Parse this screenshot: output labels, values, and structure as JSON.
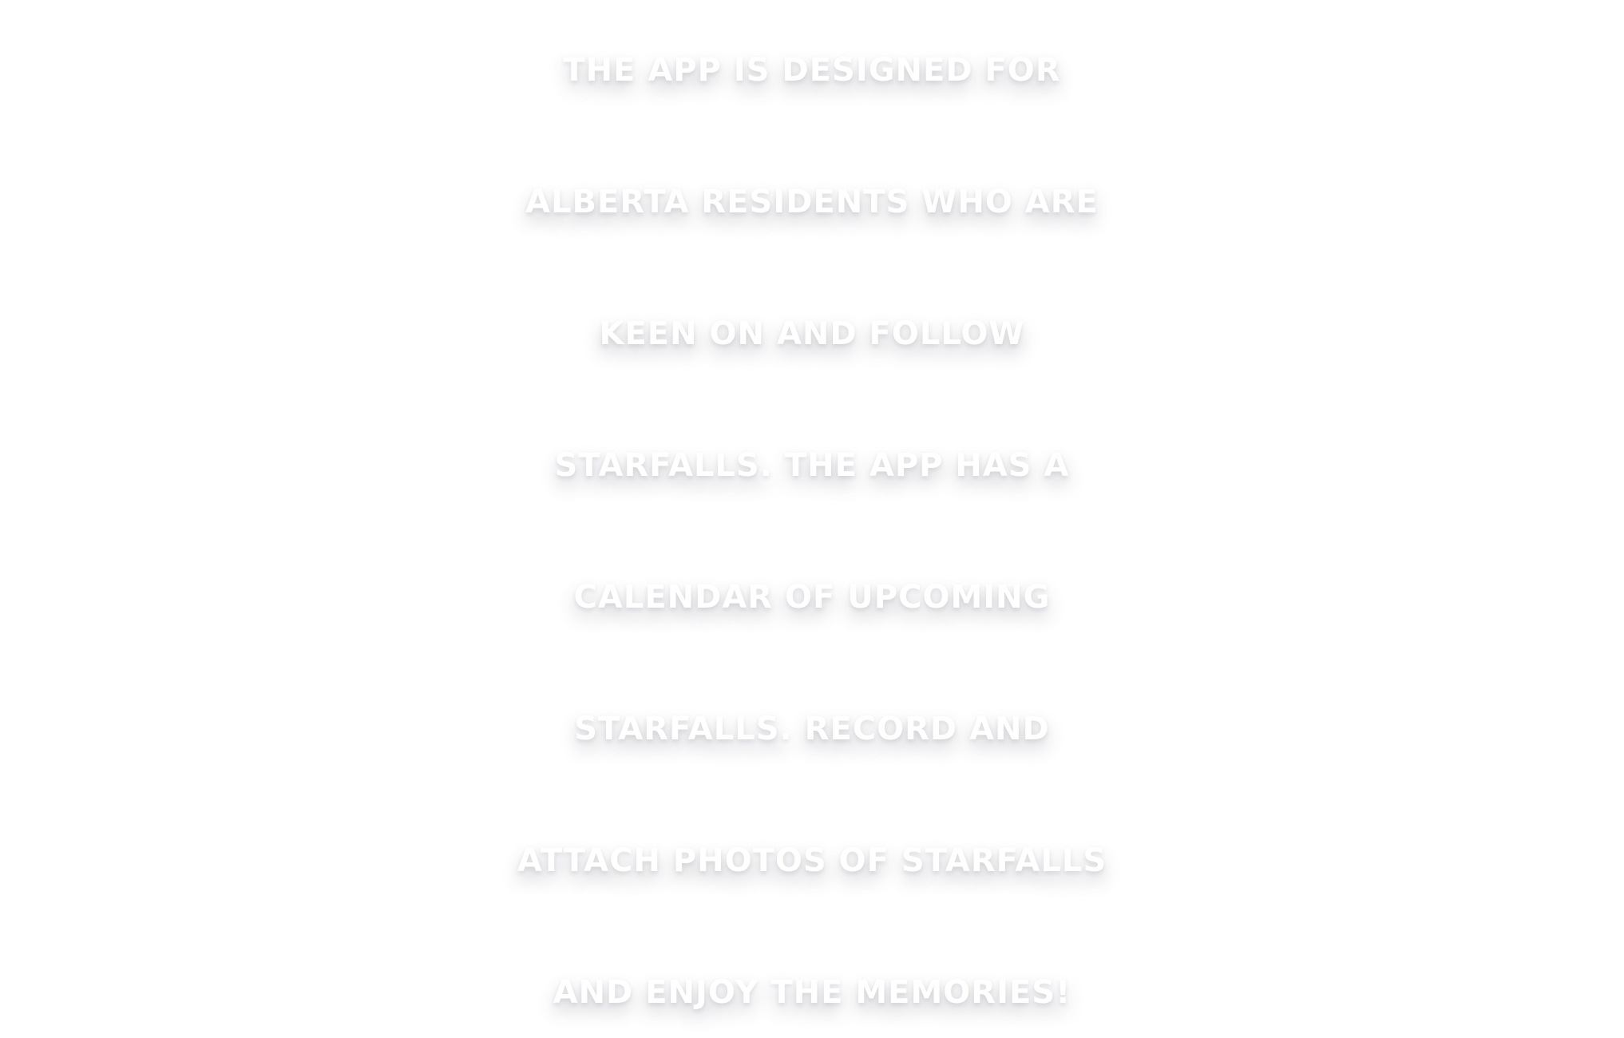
{
  "headline": {
    "lines": [
      "THE APP IS DESIGNED FOR",
      "ALBERTA RESIDENTS WHO ARE",
      "KEEN ON AND FOLLOW",
      "STARFALLS. THE APP HAS A",
      "CALENDAR OF UPCOMING",
      "STARFALLS. RECORD AND",
      "ATTACH PHOTOS OF STARFALLS",
      "AND ENJOY THE MEMORIES!"
    ]
  },
  "colors": {
    "text": "#ffffff",
    "shadow": "#3c3c50",
    "background": "#ffffff"
  }
}
